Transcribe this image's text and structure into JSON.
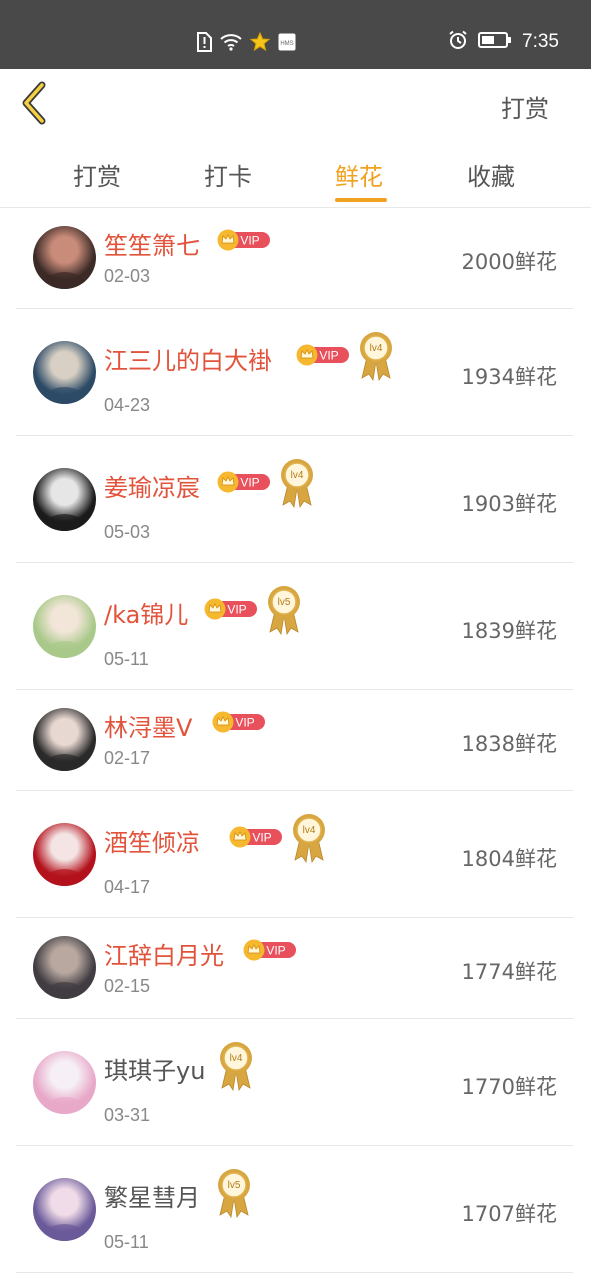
{
  "status_bar": {
    "time": "7:35",
    "icons": [
      "sim-alert-icon",
      "wifi-icon",
      "star-icon",
      "hms-icon",
      "alarm-icon",
      "battery-icon"
    ],
    "hms_label": "HMS"
  },
  "header": {
    "back_icon": "chevron-left-icon",
    "action_label": "打赏"
  },
  "tabs": [
    {
      "label": "打赏",
      "active": false
    },
    {
      "label": "打卡",
      "active": false
    },
    {
      "label": "鲜花",
      "active": true
    },
    {
      "label": "收藏",
      "active": false
    }
  ],
  "colors": {
    "accent": "#f0a21f",
    "vip_name": "#e2533b",
    "vip_badge": "#e8505b",
    "crown": "#f5b82e",
    "medal": "#d8a640"
  },
  "badge_text": "VIP",
  "list": [
    {
      "name": "笙笙箫七",
      "date": "02-03",
      "count": "2000鲜花",
      "vip": true,
      "level": ""
    },
    {
      "name": "江三儿的白大褂",
      "date": "04-23",
      "count": "1934鲜花",
      "vip": true,
      "level": "lv4"
    },
    {
      "name": "姜瑜凉宸",
      "date": "05-03",
      "count": "1903鲜花",
      "vip": true,
      "level": "lv4"
    },
    {
      "name": "/ka锦儿",
      "date": "05-11",
      "count": "1839鲜花",
      "vip": true,
      "level": "lv5"
    },
    {
      "name": "林浔墨V",
      "date": "02-17",
      "count": "1838鲜花",
      "vip": true,
      "level": ""
    },
    {
      "name": "酒笙倾凉",
      "date": "04-17",
      "count": "1804鲜花",
      "vip": true,
      "level": "lv4"
    },
    {
      "name": "江辞白月光",
      "date": "02-15",
      "count": "1774鲜花",
      "vip": true,
      "level": ""
    },
    {
      "name": "琪琪子yu",
      "date": "03-31",
      "count": "1770鲜花",
      "vip": false,
      "level": "lv4"
    },
    {
      "name": "繁星彗月",
      "date": "05-11",
      "count": "1707鲜花",
      "vip": false,
      "level": "lv5"
    }
  ]
}
